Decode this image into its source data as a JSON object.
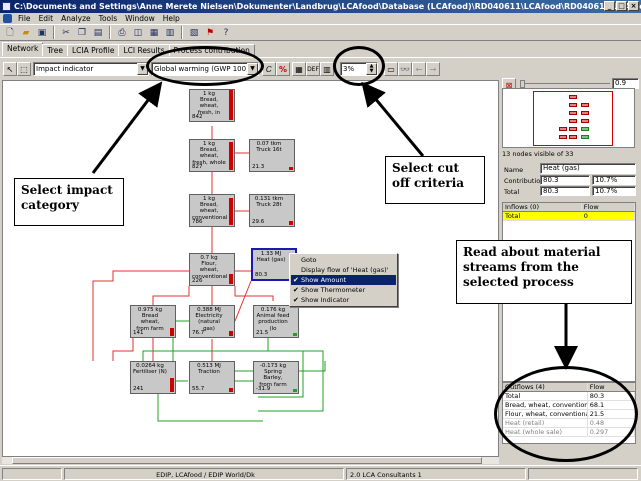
{
  "window": {
    "title": "C:\\Documents and Settings\\Anne Merete Nielsen\\Dokumenter\\Landbrug\\LCAfood\\Database (LCAfood)\\RD040611\\LCAfood\\RD040611\\LCAfood; LCAfood - [Analyze Bre..."
  },
  "menu": [
    "File",
    "Edit",
    "Analyze",
    "Tools",
    "Window",
    "Help"
  ],
  "tabs": [
    "Network",
    "Tree",
    "LCIA Profile",
    "LCI Results",
    "Process contribution"
  ],
  "toolbar2": {
    "indicator_type": "Impact indicator",
    "impact_category": "Global warming (GWP 100) (g CO",
    "cutoff": "3%"
  },
  "nodes": [
    {
      "line1": "1 kg",
      "line2": "Bread, wheat,",
      "line3": "fresh, in",
      "value": "842"
    },
    {
      "line1": "1 kg",
      "line2": "Bread, wheat,",
      "line3": "fresh, whole",
      "value": "827"
    },
    {
      "line1": "0.07 tkm",
      "line2": "Truck 16t",
      "line3": "",
      "value": "21.3"
    },
    {
      "line1": "1 kg",
      "line2": "Bread, wheat,",
      "line3": "conventional",
      "value": "786"
    },
    {
      "line1": "0.131 tkm",
      "line2": "Truck 28t",
      "line3": "",
      "value": "29.6"
    },
    {
      "line1": "0.7 kg",
      "line2": "Flour, wheat,",
      "line3": "conventional",
      "value": "226"
    },
    {
      "line1": "1.33 MJ",
      "line2": "Heat (gas)",
      "line3": "",
      "value": "80.3"
    },
    {
      "line1": "0.975 kg",
      "line2": "Bread wheat,",
      "line3": "from farm",
      "value": "141"
    },
    {
      "line1": "0.388 MJ",
      "line2": "Electricity",
      "line3": "(natural gas)",
      "value": "76.7"
    },
    {
      "line1": "0.176 kg",
      "line2": "Animal feed",
      "line3": "production (lo",
      "value": "21.5"
    },
    {
      "line1": "0.0264 kg",
      "line2": "Fertiliser (N)",
      "line3": "",
      "value": "241"
    },
    {
      "line1": "0.513 MJ",
      "line2": "Traction",
      "line3": "",
      "value": "55.7"
    },
    {
      "line1": "-0.173 kg",
      "line2": "Spring Barley,",
      "line3": "from farm",
      "value": "-31.9"
    }
  ],
  "context_menu": {
    "items": [
      "Goto",
      "Display flow of 'Heat (gas)'",
      "Show Amount",
      "Show Thermometer",
      "Show Indicator"
    ]
  },
  "right_panel": {
    "zoom_value": "0.9",
    "nodes_visible": "13 nodes visible of 33",
    "name_label": "Name",
    "name_value": "Heat (gas)",
    "contribution_label": "Contribution",
    "contribution_value": "80.3",
    "contribution_pct": "10.7%",
    "total_label": "Total",
    "total_value": "80.3",
    "total_pct": "10.7%",
    "inflows": {
      "header": "Inflows (0)",
      "flow_header": "Flow",
      "rows": [
        {
          "name": "Total",
          "flow": "0"
        }
      ]
    },
    "outflows": {
      "header": "Outflows (4)",
      "flow_header": "Flow",
      "rows": [
        {
          "name": "Total",
          "flow": "80.3"
        },
        {
          "name": "Bread, wheat, convention",
          "flow": "68.1"
        },
        {
          "name": "Flour, wheat, conventional",
          "flow": "21.5"
        },
        {
          "name": "Heat (retail)",
          "flow": "0.48"
        },
        {
          "name": "Heat (whole sale)",
          "flow": "0.297"
        }
      ]
    }
  },
  "annotations": {
    "impact": "Select impact category",
    "cutoff": "Select cut off criteria",
    "streams": "Read about material streams from the selected process"
  },
  "status": {
    "method": "EDIP, LCAfood / EDIP World/Dk",
    "version": "2.0 LCA Consultants 1"
  },
  "colors": {
    "red_link": "#e03030",
    "green_link": "#20a020",
    "selection": "#0a246a"
  }
}
